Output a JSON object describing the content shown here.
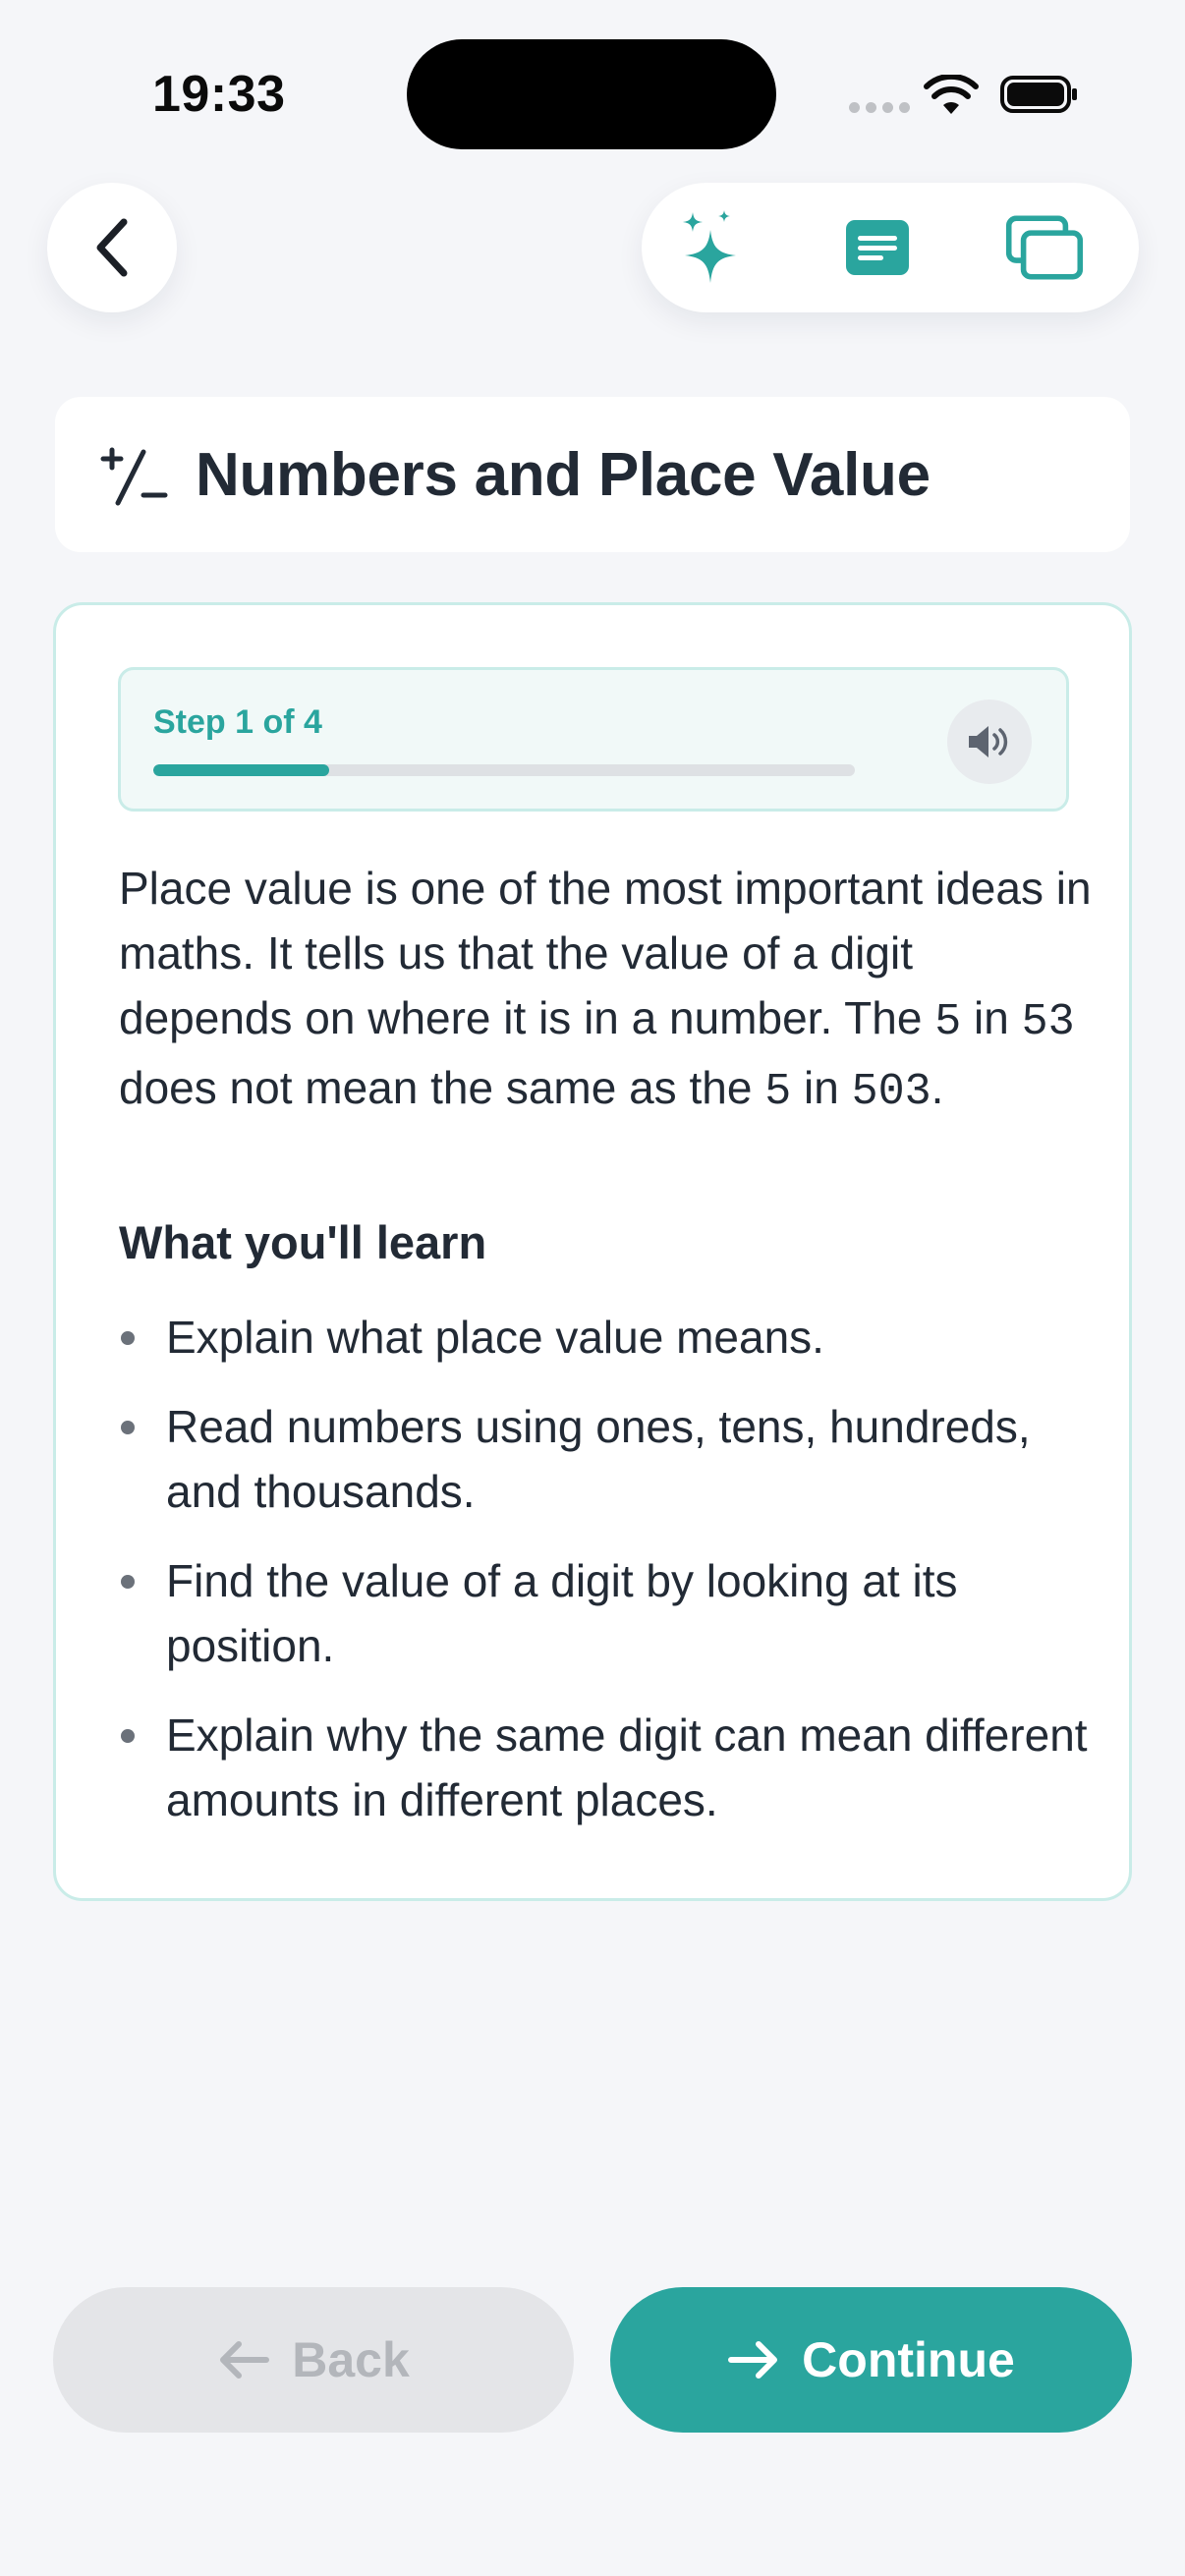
{
  "status_bar": {
    "time": "19:33"
  },
  "header": {
    "back_icon": "chevron-left-icon",
    "actions": [
      {
        "icon": "sparkles-icon"
      },
      {
        "icon": "notes-icon"
      },
      {
        "icon": "cards-icon"
      }
    ]
  },
  "title_card": {
    "icon": "plus-minus-icon",
    "title": "Numbers and Place Value"
  },
  "lesson": {
    "step_label": "Step 1 of 4",
    "step_current": 1,
    "step_total": 4,
    "speaker_icon": "speaker-icon",
    "intro_text": "Place value is one of the most important ideas in maths. It tells us that the value of a digit depends on where it is in a number. The ",
    "intro_5a": "5",
    "intro_in1": " in ",
    "intro_53": "53",
    "intro_mid": " does not mean the same as the ",
    "intro_5b": "5",
    "intro_in2": " in ",
    "intro_503": "503",
    "intro_end": ".",
    "learn_heading": "What you'll learn",
    "learn_items": [
      "Explain what place value means.",
      "Read numbers using ones, tens, hundreds, and thousands.",
      "Find the value of a digit by looking at its position.",
      "Explain why the same digit can mean different amounts in different places."
    ]
  },
  "footer": {
    "back_label": "Back",
    "continue_label": "Continue"
  },
  "colors": {
    "accent": "#2aa59e",
    "background": "#f5f6f9",
    "border": "#c9ece8",
    "text": "#222a35"
  }
}
